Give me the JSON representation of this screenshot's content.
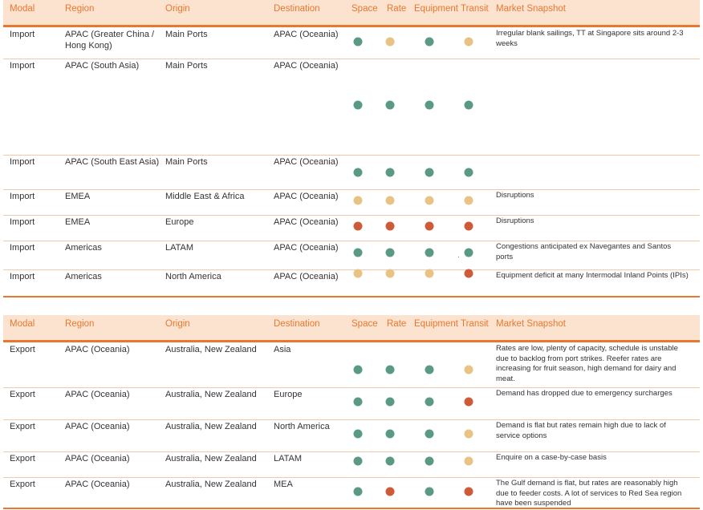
{
  "columns": [
    "Modal",
    "Region",
    "Origin",
    "Destination",
    "Space",
    "Rate",
    "Equipment",
    "Transit",
    "Market Snapshot"
  ],
  "status_colors": {
    "green": "#5a9a83",
    "amber": "#e8c383",
    "red": "#cf5a38"
  },
  "import_rows": [
    {
      "modal": "Import",
      "region": "APAC (Greater China / Hong Kong)",
      "origin": "Main Ports",
      "destination": "APAC (Oceania)",
      "space": "green",
      "rate": "amber",
      "equipment": "green",
      "transit": "amber",
      "snapshot": "Irregular blank sailings, TT at Singapore sits around 2-3 weeks"
    },
    {
      "modal": "Import",
      "region": "APAC (South Asia)",
      "origin": "Main Ports",
      "destination": "APAC (Oceania)",
      "space": "green",
      "rate": "green",
      "equipment": "green",
      "transit": "green",
      "snapshot": ""
    },
    {
      "modal": "Import",
      "region": "APAC (South East Asia)",
      "origin": "Main Ports",
      "destination": "APAC (Oceania)",
      "space": "green",
      "rate": "green",
      "equipment": "green",
      "transit": "green",
      "snapshot": ""
    },
    {
      "modal": "Import",
      "region": "EMEA",
      "origin": "Middle East & Africa",
      "destination": "APAC (Oceania)",
      "space": "amber",
      "rate": "amber",
      "equipment": "amber",
      "transit": "amber",
      "snapshot": "Disruptions"
    },
    {
      "modal": "Import",
      "region": "EMEA",
      "origin": "Europe",
      "destination": "APAC (Oceania)",
      "space": "red",
      "rate": "red",
      "equipment": "red",
      "transit": "red",
      "snapshot": "Disruptions"
    },
    {
      "modal": "Import",
      "region": "Americas",
      "origin": "LATAM",
      "destination": "APAC (Oceania)",
      "space": "green",
      "rate": "green",
      "equipment": "green",
      "transit": "green",
      "snapshot": "Congestions anticipated ex Navegantes and Santos ports"
    },
    {
      "modal": "Import",
      "region": "Americas",
      "origin": "North America",
      "destination": "APAC (Oceania)",
      "space": "amber",
      "rate": "amber",
      "equipment": "amber",
      "transit": "red",
      "snapshot": "Equipment deficit at many Intermodal Inland Points (IPIs)"
    }
  ],
  "export_rows": [
    {
      "modal": "Export",
      "region": "APAC (Oceania)",
      "origin": "Australia, New Zealand",
      "destination": "Asia",
      "space": "green",
      "rate": "green",
      "equipment": "green",
      "transit": "amber",
      "snapshot": "Rates are low, plenty of capacity, schedule is unstable due to backlog from port strikes. Reefer rates are increasing for fruit season, high demand for dairy and meat."
    },
    {
      "modal": "Export",
      "region": "APAC (Oceania)",
      "origin": "Australia, New Zealand",
      "destination": "Europe",
      "space": "green",
      "rate": "green",
      "equipment": "green",
      "transit": "red",
      "snapshot": "Demand has dropped due to emergency surcharges"
    },
    {
      "modal": "Export",
      "region": "APAC (Oceania)",
      "origin": "Australia, New Zealand",
      "destination": "North America",
      "space": "green",
      "rate": "green",
      "equipment": "green",
      "transit": "amber",
      "snapshot": "Demand is flat but rates remain high due to lack of service options"
    },
    {
      "modal": "Export",
      "region": "APAC (Oceania)",
      "origin": "Australia, New Zealand",
      "destination": "LATAM",
      "space": "green",
      "rate": "green",
      "equipment": "green",
      "transit": "amber",
      "snapshot": "Enquire on a case-by-case basis"
    },
    {
      "modal": "Export",
      "region": "APAC (Oceania)",
      "origin": "Australia, New Zealand",
      "destination": "MEA",
      "space": "green",
      "rate": "red",
      "equipment": "green",
      "transit": "red",
      "snapshot": "The Gulf demand is flat, but rates are reasonably high due to feeder costs. A lot of services to Red Sea region have been suspended"
    }
  ]
}
